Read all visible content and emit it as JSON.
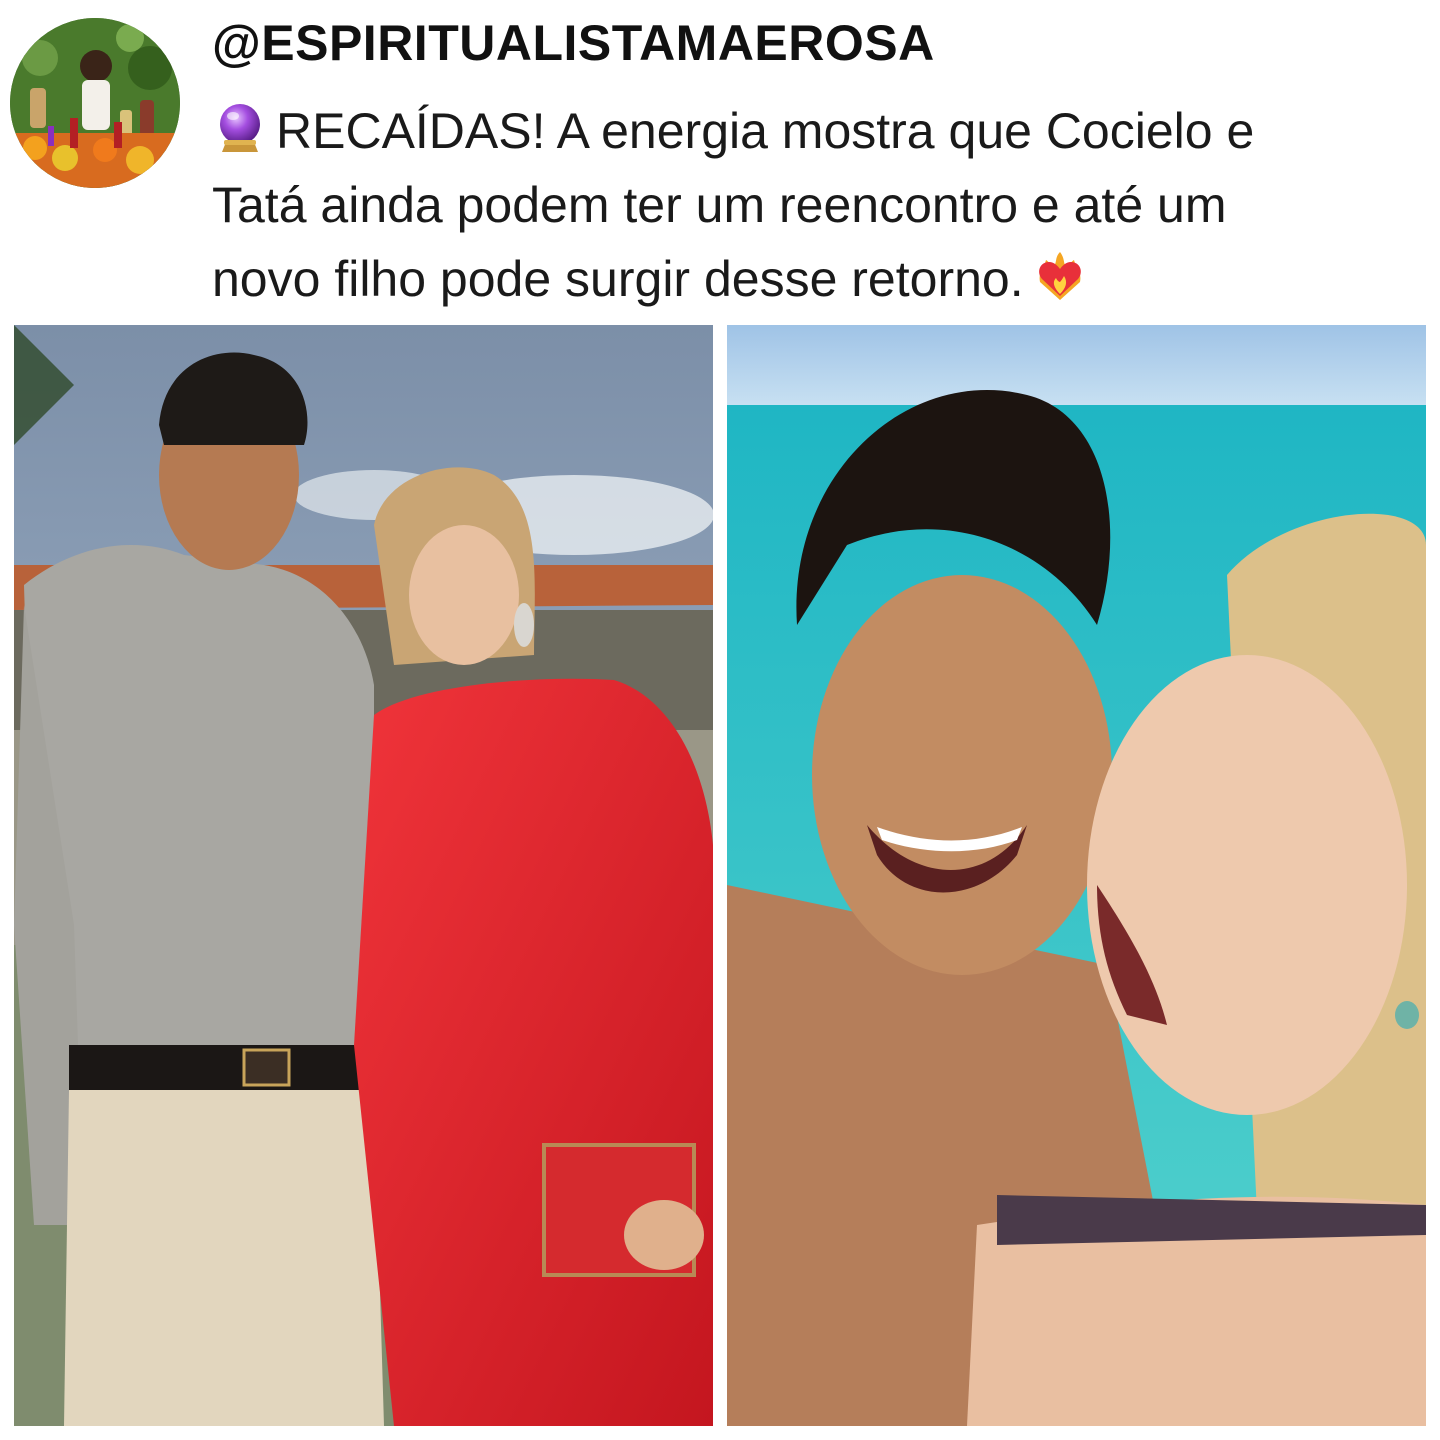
{
  "post": {
    "handle": "@ESPIRITUALISTAMAEROSA",
    "text_lines": [
      "RECAÍDAS! A energia mostra que Cocielo e",
      "Tatá ainda podem ter um reencontro e até um",
      "novo filho pode surgir desse retorno."
    ],
    "lead_emoji": "crystal-ball-icon",
    "trail_emoji": "heart-on-fire-icon"
  },
  "photos": [
    {
      "name": "couple-sunset-photo",
      "scene": "man in grey shirt and woman in red dress outdoors"
    },
    {
      "name": "couple-beach-selfie-photo",
      "scene": "couple laughing in turquoise sea"
    }
  ],
  "colors": {
    "text": "#1a1a1a",
    "dress": "#e4232b",
    "sea": "#3fc6c9"
  }
}
